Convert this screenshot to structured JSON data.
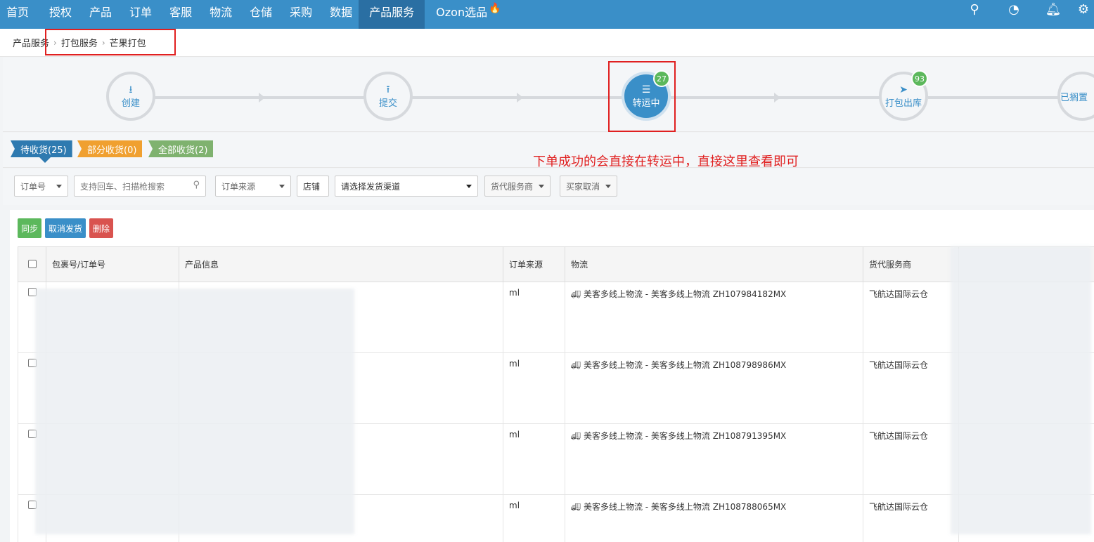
{
  "nav": {
    "items": [
      "首页",
      "授权",
      "产品",
      "订单",
      "客服",
      "物流",
      "仓储",
      "采购",
      "数据",
      "产品服务",
      "Ozon选品"
    ],
    "active_index": 9,
    "fire_icon": "fire-icon"
  },
  "breadcrumb": [
    "产品服务",
    "打包服务",
    "芒果打包"
  ],
  "steps": [
    {
      "label": "创建",
      "icon": "download-icon"
    },
    {
      "label": "提交",
      "icon": "upload-icon"
    },
    {
      "label": "转运中",
      "icon": "list-icon",
      "badge": "27",
      "active": true
    },
    {
      "label": "打包出库",
      "icon": "send-icon",
      "badge": "93"
    },
    {
      "label": "已搁置",
      "icon": ""
    }
  ],
  "receive_tabs": [
    "待收货(25)",
    "部分收货(0)",
    "全部收货(2)"
  ],
  "annotation": "下单成功的会直接在转运中，直接这里查看即可",
  "filters": {
    "order_no": "订单号",
    "search_placeholder": "支持回车、扫描枪搜索",
    "order_source": "订单来源",
    "store": "店铺",
    "channel": "请选择发货渠道",
    "forwarder": "货代服务商",
    "buyer_cancel": "买家取消"
  },
  "actions": {
    "sync": "同步",
    "cancel_ship": "取消发货",
    "delete": "删除"
  },
  "table": {
    "headers": [
      "包裹号/订单号",
      "产品信息",
      "订单来源",
      "物流",
      "货代服务商"
    ],
    "rows": [
      {
        "source": "ml",
        "logistics": "美客多线上物流 - 美客多线上物流 ZH107984182MX",
        "forwarder": "飞航达国际云仓"
      },
      {
        "source": "ml",
        "logistics": "美客多线上物流 - 美客多线上物流 ZH108798986MX",
        "forwarder": "飞航达国际云仓"
      },
      {
        "source": "ml",
        "logistics": "美客多线上物流 - 美客多线上物流 ZH108791395MX",
        "forwarder": "飞航达国际云仓"
      },
      {
        "source": "ml",
        "logistics": "美客多线上物流 - 美客多线上物流 ZH108788065MX",
        "forwarder": "飞航达国际云仓"
      }
    ]
  }
}
